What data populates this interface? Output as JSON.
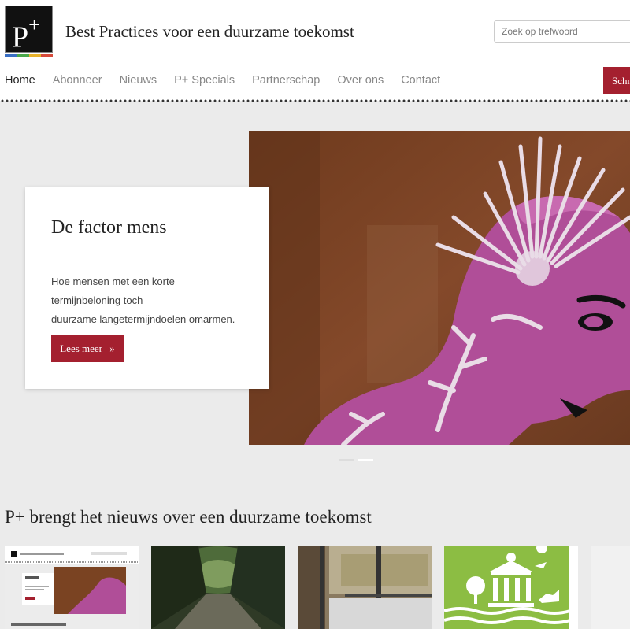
{
  "site": {
    "logo_text": "P",
    "logo_plus": "+",
    "title": "Best Practices voor een duurzame toekomst",
    "logo_colors": [
      "#3a6fc4",
      "#4aa84a",
      "#e8b22a",
      "#d64a3a"
    ]
  },
  "search": {
    "placeholder": "Zoek op trefwoord"
  },
  "nav": {
    "items": [
      {
        "label": "Home",
        "active": true
      },
      {
        "label": "Abonneer"
      },
      {
        "label": "Nieuws"
      },
      {
        "label": "P+ Specials"
      },
      {
        "label": "Partnerschap"
      },
      {
        "label": "Over ons"
      },
      {
        "label": "Contact"
      }
    ],
    "subscribe_label": "Schrijf"
  },
  "hero": {
    "title": "De factor mens",
    "text_lines": [
      "Hoe mensen met een korte",
      "termijnbeloning toch",
      "duurzame langetermijndoelen omarmen."
    ],
    "button_label": "Lees meer",
    "button_icon": "double-chevron-right-icon",
    "slide_count": 2,
    "active_slide": 2
  },
  "news": {
    "title": "P+ brengt het nieuws over een duurzame toekomst"
  },
  "colors": {
    "accent": "#a4202f",
    "background": "#ebebeb",
    "hero_brown": "#7a4322",
    "hero_pink": "#b04e98"
  }
}
